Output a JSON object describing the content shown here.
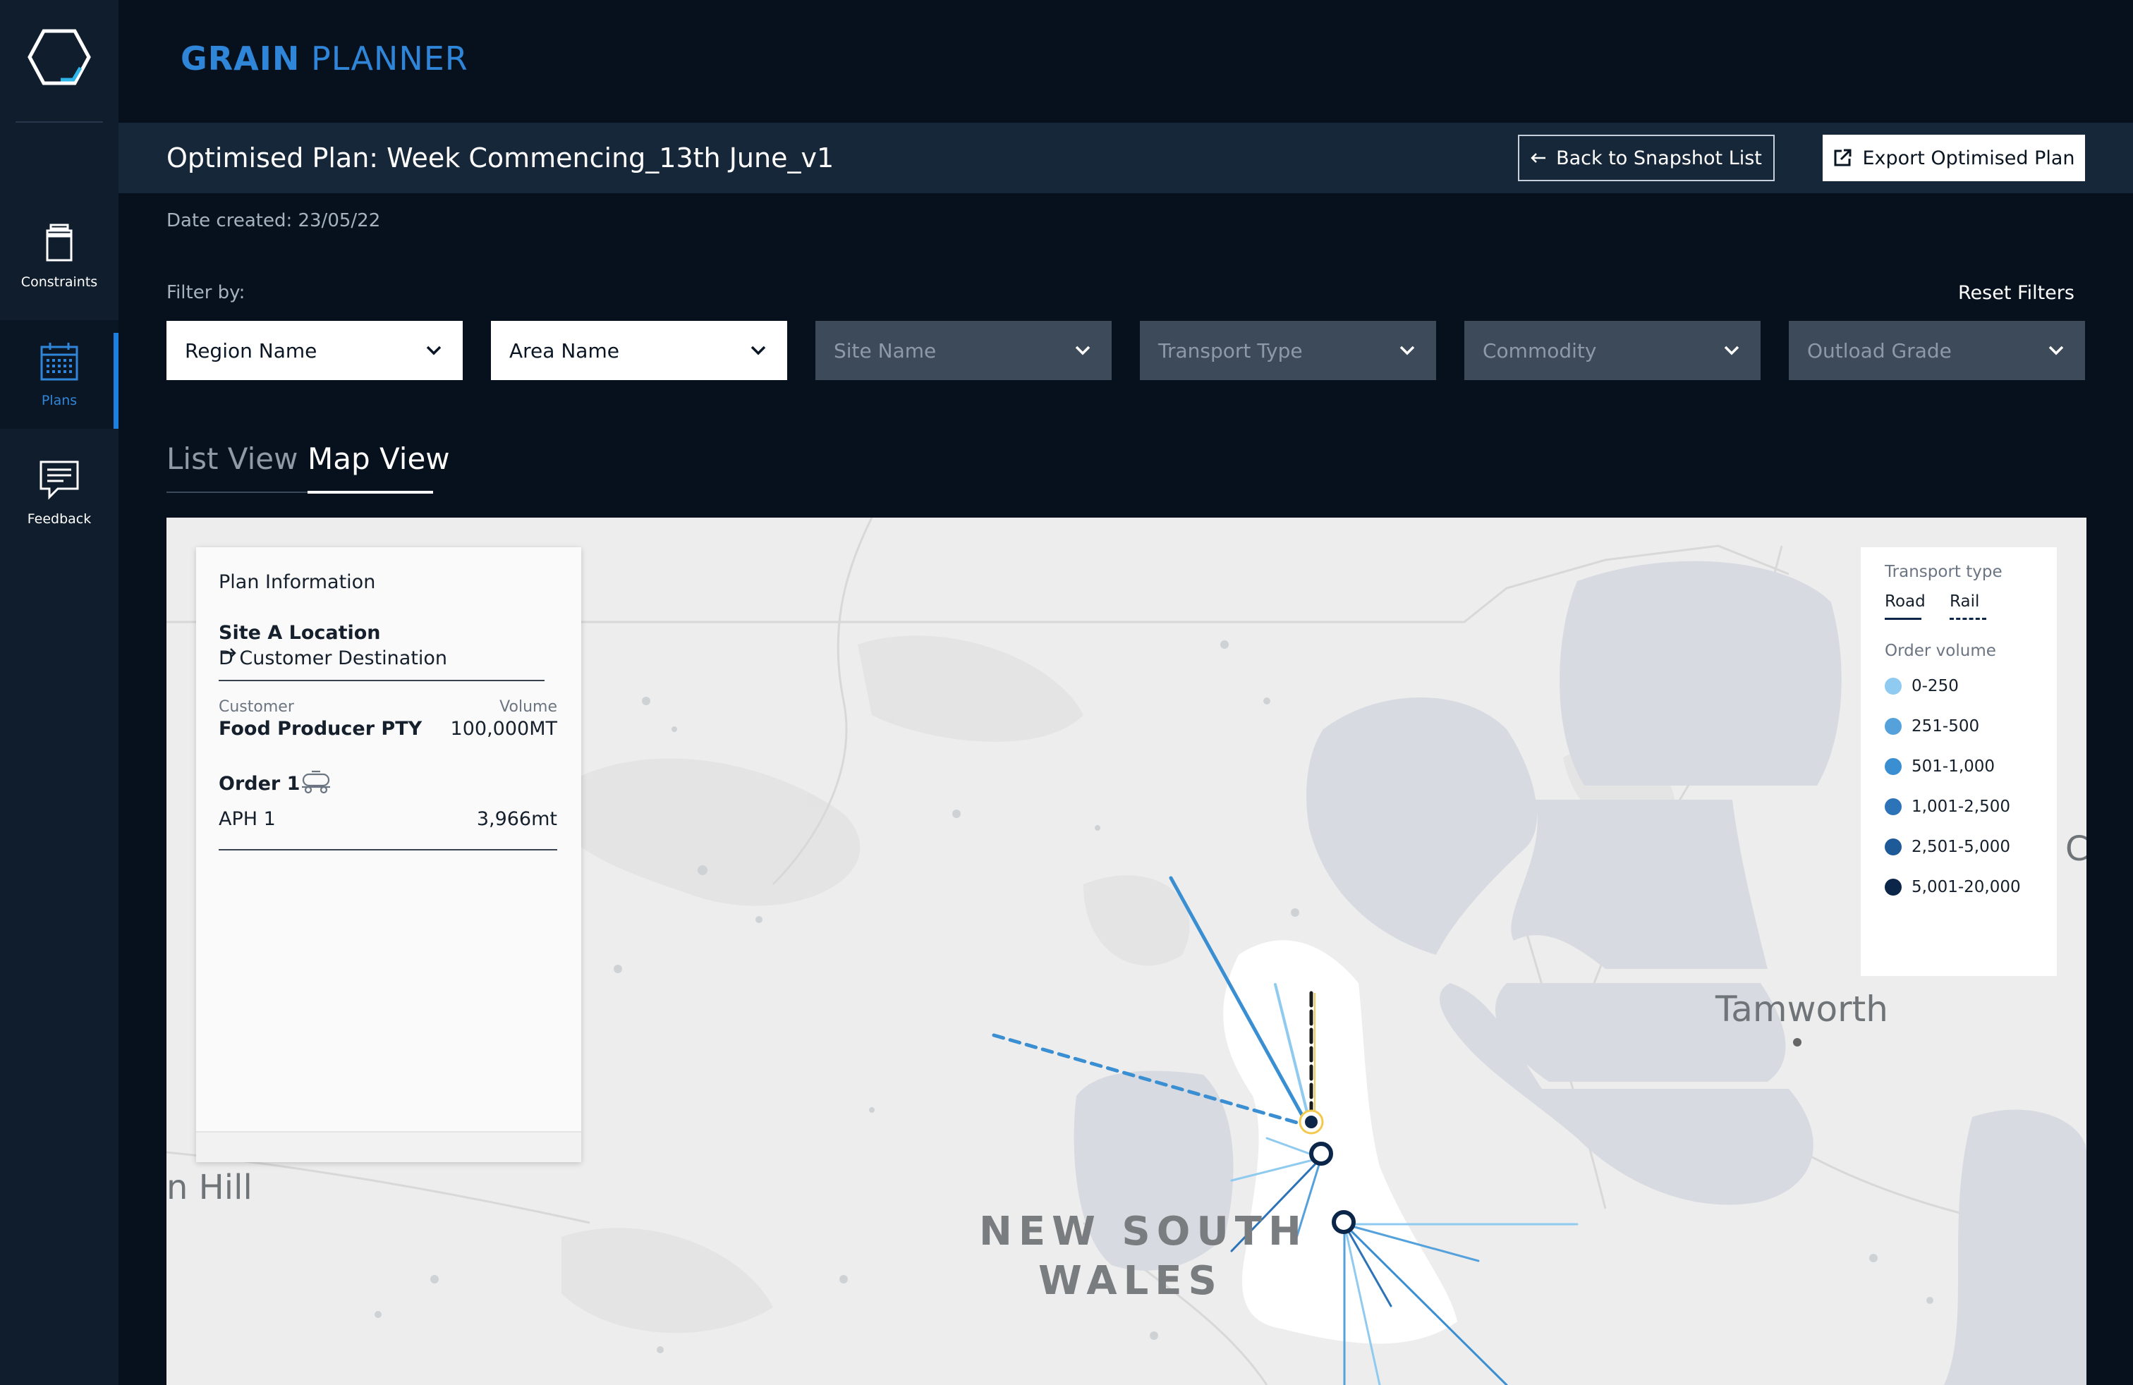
{
  "sidebar": {
    "items": [
      {
        "label": "Constraints",
        "icon": "container-icon"
      },
      {
        "label": "Plans",
        "icon": "calendar-icon",
        "active": true
      },
      {
        "label": "Feedback",
        "icon": "feedback-icon"
      }
    ]
  },
  "header": {
    "brand_1": "GRAIN",
    "brand_2": "PLANNER",
    "title": "Optimised Plan: Week Commencing_13th June_v1",
    "back_label": "Back to Snapshot List",
    "export_label": "Export Optimised Plan",
    "date_created": "Date created: 23/05/22"
  },
  "filters": {
    "label": "Filter by:",
    "reset_label": "Reset Filters",
    "items": [
      {
        "label": "Region Name",
        "enabled": true
      },
      {
        "label": "Area Name",
        "enabled": true
      },
      {
        "label": "Site Name",
        "enabled": false
      },
      {
        "label": "Transport Type",
        "enabled": false
      },
      {
        "label": "Commodity",
        "enabled": false
      },
      {
        "label": "Outload Grade",
        "enabled": false
      }
    ]
  },
  "tabs": [
    {
      "label": "List View",
      "active": false
    },
    {
      "label": "Map View",
      "active": true
    }
  ],
  "plan_info": {
    "heading": "Plan Information",
    "site": "Site A Location",
    "destination": "D Customer Destination",
    "customer_label": "Customer",
    "customer": "Food Producer PTY",
    "volume_label": "Volume",
    "volume": "100,000MT",
    "order": "Order 1",
    "grade": "APH 1",
    "order_amount": "3,966mt"
  },
  "legend": {
    "transport_title": "Transport type",
    "road": "Road",
    "rail": "Rail",
    "volume_title": "Order volume",
    "bins": [
      {
        "label": "0-250",
        "color": "#8fcaf0"
      },
      {
        "label": "251-500",
        "color": "#54a1dc"
      },
      {
        "label": "501-1,000",
        "color": "#3a8ed2"
      },
      {
        "label": "1,001-2,500",
        "color": "#2c73b8"
      },
      {
        "label": "2,501-5,000",
        "color": "#1e5a98"
      },
      {
        "label": "5,001-20,000",
        "color": "#0b2648"
      }
    ]
  },
  "map": {
    "labels": {
      "tamworth": "Tamworth",
      "nsw_1": "NEW SOUTH",
      "nsw_2": "WALES",
      "hill": "n Hill",
      "edge_c": "C"
    }
  },
  "colors": {
    "accent": "#2f86d9",
    "background": "#07111e"
  }
}
